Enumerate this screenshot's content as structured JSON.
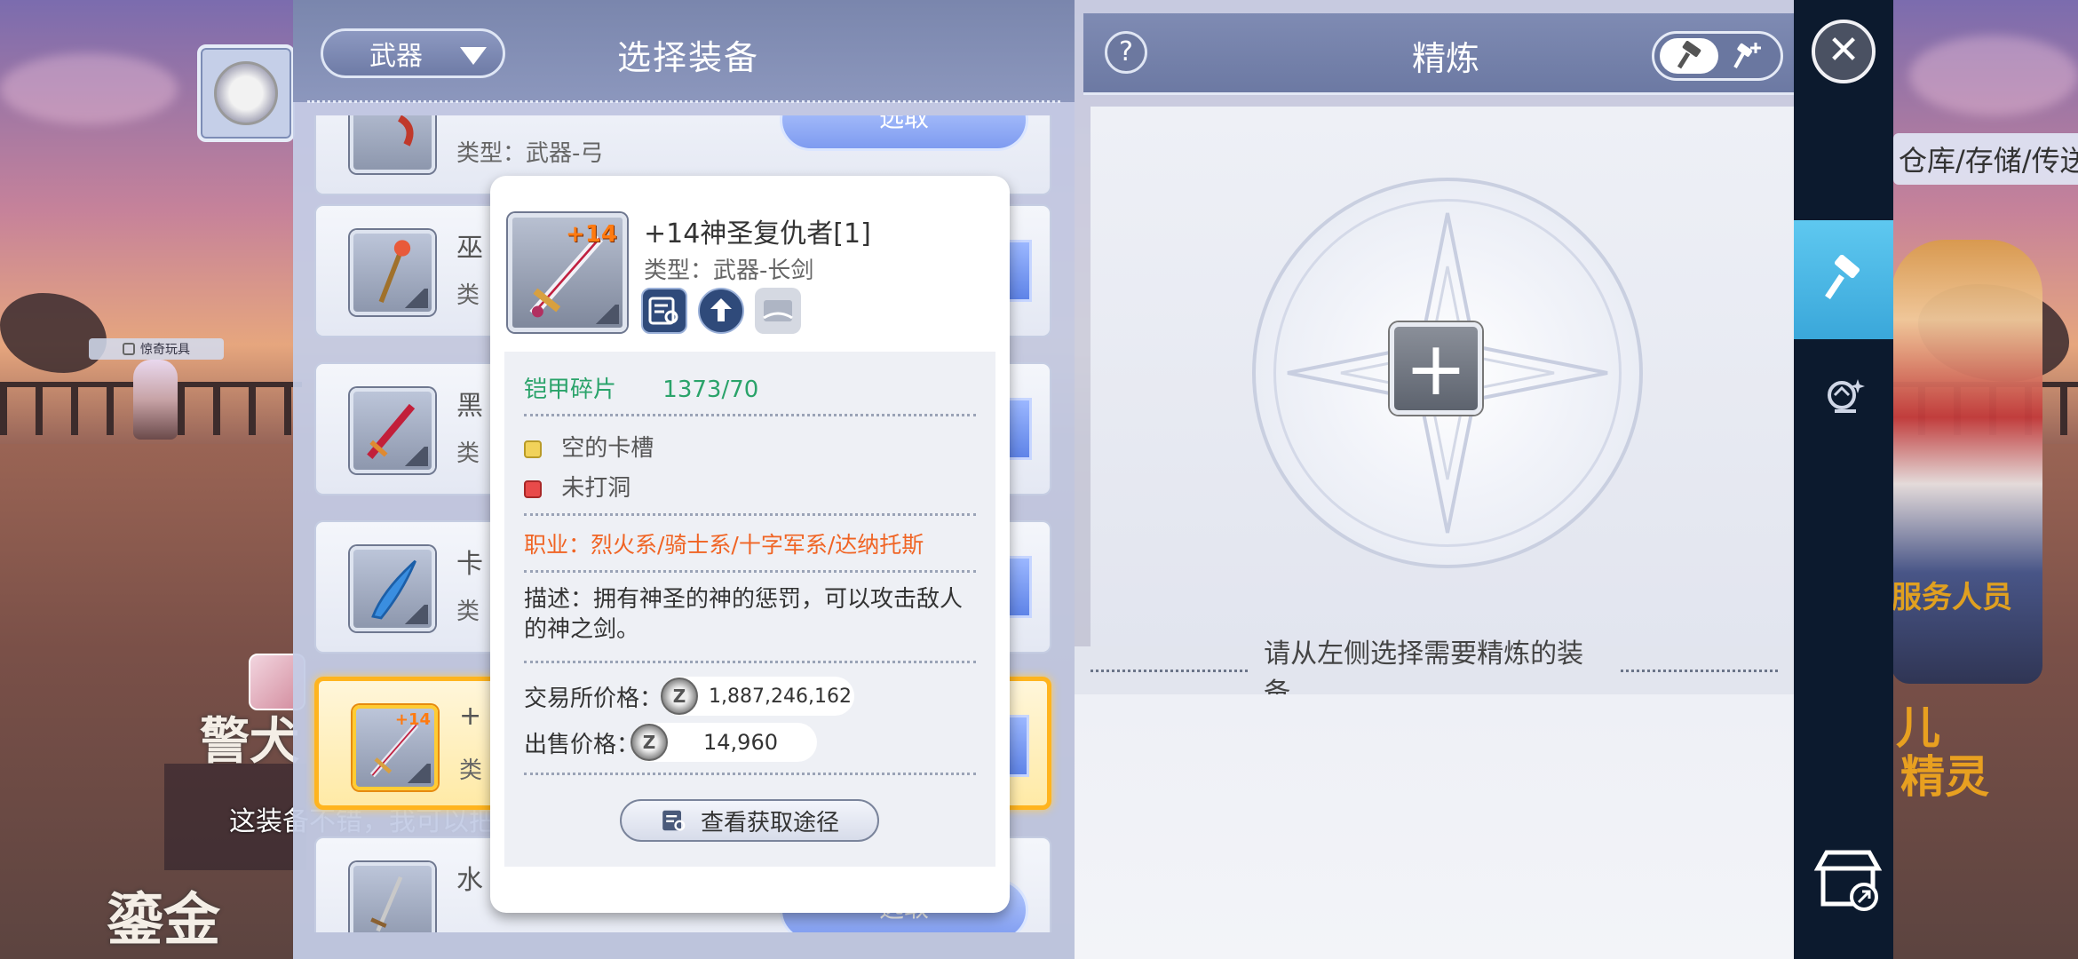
{
  "background": {
    "npc_tag": "惊奇玩具",
    "chat_text": "这装备不错，我可以把",
    "big_text_1": "警犬",
    "big_text_2": "鎏金",
    "right_box_text": "仓库/存储/传送",
    "right_text_service": "服务人员",
    "right_text_1": "儿",
    "right_text_2": "精灵"
  },
  "select_panel": {
    "filter_label": "武器",
    "title": "选择装备",
    "top_card_type": "类型：武器-弓",
    "choose_label": "选取",
    "cards": [
      {
        "name": "巫",
        "type": "类"
      },
      {
        "name": "黑",
        "type": "类"
      },
      {
        "name": "卡",
        "type": "类"
      },
      {
        "name": "+",
        "type": "类",
        "plus": "+14"
      },
      {
        "name": "水",
        "type": ""
      }
    ],
    "bottom_choose_label": "选取"
  },
  "tooltip": {
    "plus_level": "+14",
    "item_name": "+14神圣复仇者[1]",
    "item_type": "类型：武器-长剑",
    "material_label": "铠甲碎片",
    "material_value": "1373/70",
    "slot_empty": "空的卡槽",
    "slot_not_drilled": "未打洞",
    "job": "职业：烈火系/骑士系/十字军系/达纳托斯",
    "description": "描述：拥有神圣的神的惩罚，可以攻击敌人的神之剑。",
    "exchange_price_label": "交易所价格：",
    "exchange_price": "1,887,246,162",
    "sell_price_label": "出售价格：",
    "sell_price": "14,960",
    "coin_symbol": "Z",
    "get_route_button": "查看获取途径"
  },
  "refine_panel": {
    "help_label": "?",
    "title": "精炼",
    "add_label": "+",
    "hint": "请从左侧选择需要精炼的装备"
  },
  "rail": {
    "close_label": "✕"
  },
  "colors": {
    "accent_orange": "#f06424",
    "material_green": "#2aa36a",
    "selected_border": "#ffb41e",
    "active_tab": "#3aa7da"
  }
}
